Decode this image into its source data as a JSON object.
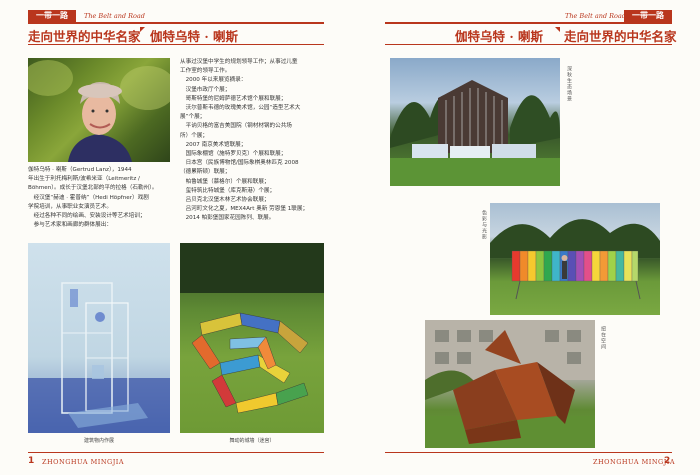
{
  "header_left": {
    "tag": "一带一路",
    "tag_en": "The Belt and Road",
    "section": "走向世界的中华名家",
    "name": "伽特乌特 · 喇斯"
  },
  "header_right": {
    "tag": "一带一路",
    "tag_en": "The Belt and Road",
    "section": "走向世界的中华名家",
    "name": "伽特乌特 · 喇斯"
  },
  "bio": {
    "lines": [
      "伽特乌特 · 喇斯（Gertrud Lanz），1944",
      "年出生于利托梅利斯/波希米亚（Leitmeritz /",
      "Böhmen）。成长于汉堡北部的平的拉格（石勒州）。",
      "　经汉堡“赫迪 · 霍普纳”（Hedi Höpfner）戏剧",
      "学院培训，从事职业女演员艺术。",
      "　经过各种不同的绘画、安装设计等艺术培训；",
      "　参与艺术家和画廊的群体展出："
    ]
  },
  "works": {
    "lines": [
      "从事过汉堡中学生的规划领导工作；从事过儿童",
      "工作室的领导工作。",
      "　2000 年以来展览摘录：",
      "　汉堡市政厅个展；",
      "　哥斯特堡的尼姆萨德艺术馆个展和联展；",
      "　沃尔普斯韦德的玫瑰美术馆，公园“造型艺术大",
      "展”个展；",
      "　平讷贝格的富吉美国院（钢材材钢的公共场",
      "所）个展；",
      "　2007 南京美术馆联展；",
      "　国际象棚馆（施特罗贝克）个展和联展；",
      "　日本宫（民族博物馆/国际象棋奥林匹克 2008",
      "（德累斯顿）联展；",
      "　帕鲁城堡（慕格尔）个展和联展；",
      "　玺特筑比特城堡（库克斯港）个展；",
      "　吕贝克北汉堡木林艺术协会联展；",
      "　吕河町文化之夏，MEX4Art 奥新 劳恩堡 1联展；",
      "　2014 帕彭堡国家花园陈列、联展。"
    ]
  },
  "captions": {
    "cap1": "建筑物内作展",
    "cap2": "舞动的城墙（迷宫）",
    "vcap1": "深秋生态场景",
    "vcap2": "色彩与光影",
    "vcap3": "扭在空间"
  },
  "footer": {
    "left_num": "1",
    "left_name": "ZHONGHUA MINGJIA",
    "right_num": "2",
    "right_name": "ZHONGHUA MINGJIA"
  },
  "colors": {
    "accent": "#b9361d",
    "page": "#fdfcf8"
  }
}
